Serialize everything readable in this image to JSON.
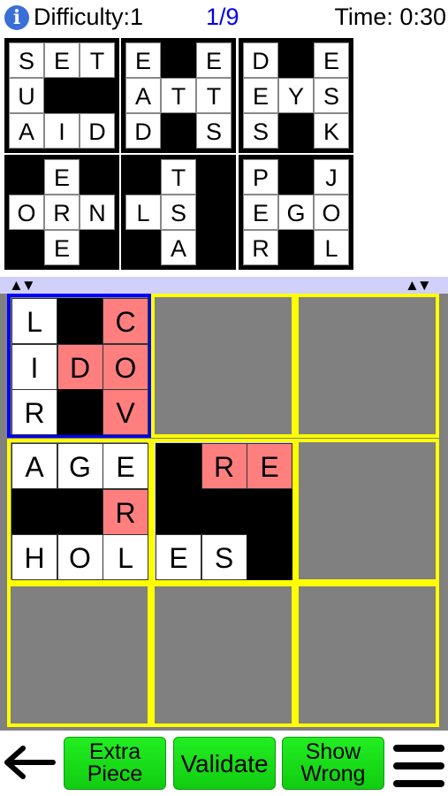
{
  "header": {
    "info_icon": "info-icon",
    "difficulty": "Difficulty:1",
    "progress": "1/9",
    "timer": "Time: 0:30"
  },
  "pieces": [
    {
      "name": "piece-1",
      "cells": [
        [
          "S",
          "E",
          "T"
        ],
        [
          "U",
          "#",
          "#"
        ],
        [
          "A",
          "I",
          "D"
        ]
      ]
    },
    {
      "name": "piece-2",
      "cells": [
        [
          "E",
          "#",
          "E"
        ],
        [
          "A",
          "T",
          "T"
        ],
        [
          "D",
          "#",
          "S"
        ]
      ]
    },
    {
      "name": "piece-3",
      "cells": [
        [
          "D",
          "#",
          "E"
        ],
        [
          "E",
          "Y",
          "S"
        ],
        [
          "S",
          "#",
          "K"
        ]
      ]
    },
    {
      "name": "piece-4",
      "cells": [
        [
          "#",
          "E",
          "#"
        ],
        [
          "O",
          "R",
          "N"
        ],
        [
          "#",
          "E",
          "#"
        ]
      ]
    },
    {
      "name": "piece-5",
      "cells": [
        [
          "#",
          "T",
          "#"
        ],
        [
          "L",
          "S",
          "#"
        ],
        [
          "#",
          "A",
          "#"
        ]
      ]
    },
    {
      "name": "piece-6",
      "cells": [
        [
          "P",
          "#",
          "J"
        ],
        [
          "E",
          "G",
          "O"
        ],
        [
          "R",
          "#",
          "L"
        ]
      ]
    }
  ],
  "scroll_arrows": {
    "left": "▲▼",
    "right": "▲▼"
  },
  "board": {
    "slots": [
      {
        "row": 0,
        "col": 0,
        "selected": true,
        "cells": [
          [
            "L",
            "#",
            "C*"
          ],
          [
            "I",
            "D*",
            "O*"
          ],
          [
            "R",
            "#",
            "V*"
          ]
        ]
      },
      {
        "row": 0,
        "col": 1,
        "cells": null
      },
      {
        "row": 0,
        "col": 2,
        "cells": null
      },
      {
        "row": 1,
        "col": 0,
        "cells": [
          [
            "A",
            "G",
            "E"
          ],
          [
            "#",
            "#",
            "R*"
          ],
          [
            "H",
            "O",
            "L"
          ]
        ]
      },
      {
        "row": 1,
        "col": 1,
        "highlight": true,
        "cells": [
          [
            "#",
            "R*",
            "E*"
          ],
          [
            "#",
            "#",
            "#"
          ],
          [
            "E",
            "S",
            "#"
          ]
        ]
      },
      {
        "row": 1,
        "col": 2,
        "cells": null
      },
      {
        "row": 2,
        "col": 0,
        "cells": null
      },
      {
        "row": 2,
        "col": 1,
        "cells": null
      },
      {
        "row": 2,
        "col": 2,
        "cells": null
      }
    ],
    "colors": {
      "slot_border": "#ffff00",
      "selected_border": "#0000ff",
      "wrong_cell": "#ff7f7f",
      "background": "#808080"
    }
  },
  "footer": {
    "back_icon": "arrow-left-icon",
    "extra_piece": [
      "Extra",
      "Piece"
    ],
    "validate": "Validate",
    "show_wrong": [
      "Show",
      "Wrong"
    ],
    "menu_icon": "hamburger-menu-icon",
    "button_color": "#1ee01e"
  }
}
